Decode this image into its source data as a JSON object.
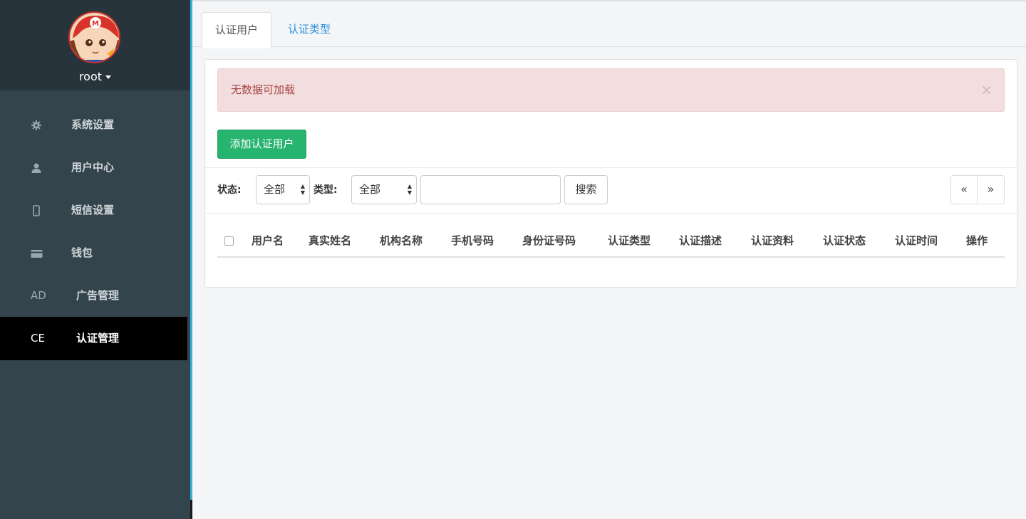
{
  "sidebar": {
    "user": {
      "name": "root"
    },
    "items": [
      {
        "icon": "gear-icon",
        "label": "系统设置",
        "active": false
      },
      {
        "icon": "user-icon",
        "label": "用户中心",
        "active": false
      },
      {
        "icon": "mobile-icon",
        "label": "短信设置",
        "active": false
      },
      {
        "icon": "credit-card-icon",
        "label": "钱包",
        "active": false
      },
      {
        "icon_text": "AD",
        "label": "广告管理",
        "active": false
      },
      {
        "icon_text": "CE",
        "label": "认证管理",
        "active": true
      }
    ]
  },
  "tabs": [
    {
      "label": "认证用户",
      "active": true
    },
    {
      "label": "认证类型",
      "active": false
    }
  ],
  "alert": {
    "message": "无数据可加载",
    "close": "×"
  },
  "add_button": "添加认证用户",
  "filters": {
    "status_label": "状态:",
    "status_value": "全部",
    "type_label": "类型:",
    "type_value": "全部",
    "search_value": "",
    "search_button": "搜索"
  },
  "pager": {
    "prev": "«",
    "next": "»"
  },
  "table": {
    "columns": [
      "用户名",
      "真实姓名",
      "机构名称",
      "手机号码",
      "身份证号码",
      "认证类型",
      "认证描述",
      "认证资料",
      "认证状态",
      "认证时间",
      "操作"
    ],
    "rows": []
  },
  "colors": {
    "sidebar_bg": "#33444d",
    "sidebar_active_bg": "#000000",
    "accent": "#3ab0d8",
    "primary_button": "#27b46e",
    "alert_bg": "#f2dede",
    "alert_text": "#a94442",
    "tab_link": "#2e8ed8"
  }
}
